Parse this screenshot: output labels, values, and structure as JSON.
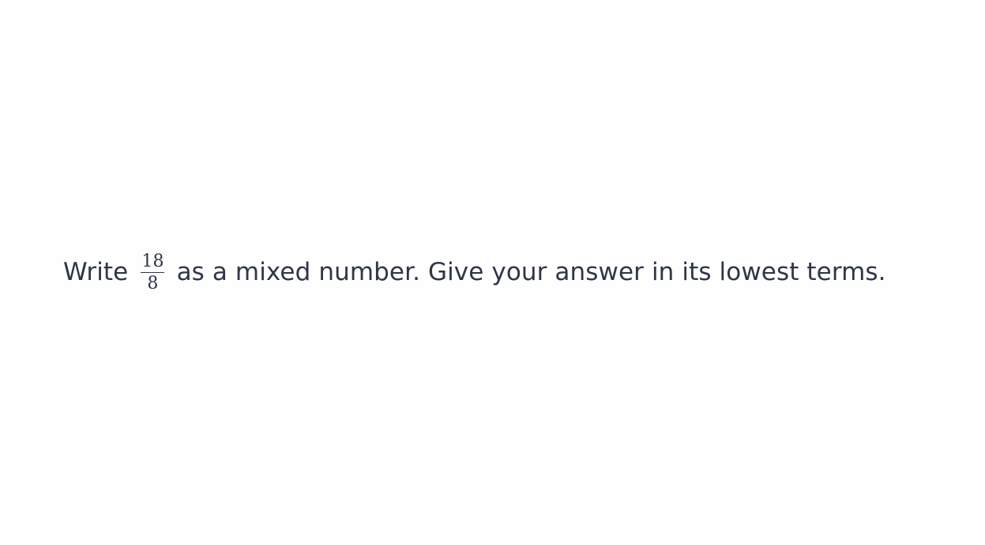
{
  "question": {
    "prefix": "Write",
    "fraction": {
      "numerator": "18",
      "denominator": "8"
    },
    "suffix": "as a mixed number. Give your answer in its lowest terms."
  },
  "colors": {
    "background": "#fefefe",
    "text": "#2f3648"
  }
}
